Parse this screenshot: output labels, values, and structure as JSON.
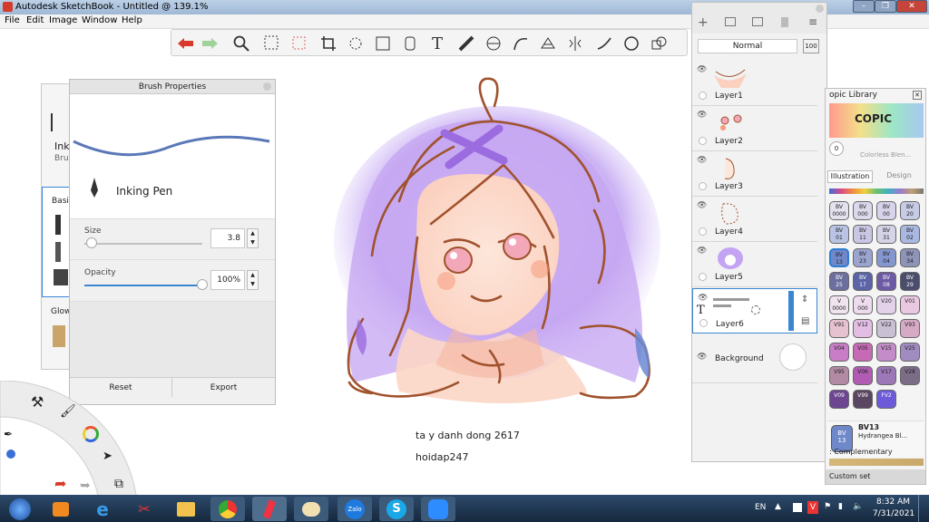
{
  "window": {
    "title": "Autodesk SketchBook - Untitled @ 139.1%"
  },
  "menu": {
    "items": [
      "File",
      "Edit",
      "Image",
      "Window",
      "Help"
    ]
  },
  "toolbar": {
    "tools": [
      "undo-icon",
      "redo-icon",
      "zoom-icon",
      "select-icon",
      "lasso-select-icon",
      "crop-icon",
      "transform-icon",
      "distort-icon",
      "fill-icon",
      "text-icon",
      "ruler-icon",
      "ellipse-guide-icon",
      "french-curve-icon",
      "perspective-icon",
      "symmetry-icon",
      "stroke-icon",
      "ellipse-icon",
      "shape-icon"
    ]
  },
  "brush_properties": {
    "title": "Brush Properties",
    "brush_name": "Inking Pen",
    "size_label": "Size",
    "size_value": "3.8",
    "size_fraction": 0.06,
    "opacity_label": "Opacity",
    "opacity_value": "100%",
    "opacity_fraction": 1.0,
    "reset_label": "Reset",
    "export_label": "Export"
  },
  "brush_library": {
    "name_partial": "Ink",
    "sub_partial": "Brus",
    "section_partial": "Basic",
    "section2_partial": "Glow"
  },
  "layers": {
    "blend_mode": "Normal",
    "opacity_badge": "100",
    "items": [
      {
        "name": "Layer1"
      },
      {
        "name": "Layer2"
      },
      {
        "name": "Layer3"
      },
      {
        "name": "Layer4"
      },
      {
        "name": "Layer5"
      },
      {
        "name": "Layer6"
      },
      {
        "name": "Background"
      }
    ]
  },
  "copic": {
    "title": "opic Library",
    "brand": "COPIC",
    "colorless": "0",
    "colorless_label": "Colorless Blen...",
    "tab_illustration": "Illustration",
    "tab_design": "Design",
    "swatches": [
      {
        "code": "BV\n0000",
        "color": "#e4e2ef"
      },
      {
        "code": "BV\n000",
        "color": "#dcd9ec"
      },
      {
        "code": "BV\n00",
        "color": "#d6d3ea"
      },
      {
        "code": "BV\n20",
        "color": "#c7cbe6"
      },
      {
        "code": "BV\n01",
        "color": "#b9c4e4"
      },
      {
        "code": "BV\n11",
        "color": "#c9c6e3"
      },
      {
        "code": "BV\n31",
        "color": "#d5d3e8"
      },
      {
        "code": "BV\n02",
        "color": "#a9b8e2"
      },
      {
        "code": "BV\n13",
        "color": "#6f88c9"
      },
      {
        "code": "BV\n23",
        "color": "#9aa4cf"
      },
      {
        "code": "BV\n04",
        "color": "#8597cf"
      },
      {
        "code": "BV\n34",
        "color": "#8e93b8"
      },
      {
        "code": "BV\n25",
        "color": "#6c6f9e"
      },
      {
        "code": "BV\n17",
        "color": "#5a64a6"
      },
      {
        "code": "BV\n08",
        "color": "#6d5aa4"
      },
      {
        "code": "BV\n29",
        "color": "#4a4d6c"
      },
      {
        "code": "V\n0000",
        "color": "#f0e4ef"
      },
      {
        "code": "V\n000",
        "color": "#eedcee"
      },
      {
        "code": "V20",
        "color": "#e3d1ea"
      },
      {
        "code": "V01",
        "color": "#ebc8e2"
      },
      {
        "code": "V91",
        "color": "#e6c2d1"
      },
      {
        "code": "V12",
        "color": "#e2bde4"
      },
      {
        "code": "V22",
        "color": "#c9c0d3"
      },
      {
        "code": "V93",
        "color": "#d6a9c4"
      },
      {
        "code": "V04",
        "color": "#c97dc7"
      },
      {
        "code": "V05",
        "color": "#c76ab6"
      },
      {
        "code": "V15",
        "color": "#c48cc8"
      },
      {
        "code": "V25",
        "color": "#a08cc1"
      },
      {
        "code": "V95",
        "color": "#b38aa4"
      },
      {
        "code": "V06",
        "color": "#b05cb2"
      },
      {
        "code": "V17",
        "color": "#9c78b8"
      },
      {
        "code": "V28",
        "color": "#7b6d87"
      },
      {
        "code": "V09",
        "color": "#6e4591"
      },
      {
        "code": "V99",
        "color": "#5a4660"
      },
      {
        "code": "FV2",
        "color": "#6d5ad8"
      }
    ],
    "selected_code": "BV\n13",
    "selected_name": "BV13",
    "selected_desc": "Hydrangea Bl...",
    "complementary": ": Complementary",
    "custom_set": "Custom set"
  },
  "canvas": {
    "caption1": "ta y danh dong 2617",
    "caption2": "hoidap247"
  },
  "taskbar": {
    "apps": [
      "start-icon",
      "media-player-icon",
      "ie-icon",
      "snipping-icon",
      "explorer-icon",
      "chrome-icon",
      "sketchbook-icon",
      "paint-icon",
      "zalo-icon",
      "skype-icon",
      "zoom-icon"
    ],
    "zalo_label": "Zalo",
    "lang": "EN",
    "time": "8:32 AM",
    "date": "7/31/2021"
  },
  "colors": {
    "purple": "#b08ce8",
    "hair_line": "#a0522d",
    "accent_blue": "#2f7bd0"
  }
}
